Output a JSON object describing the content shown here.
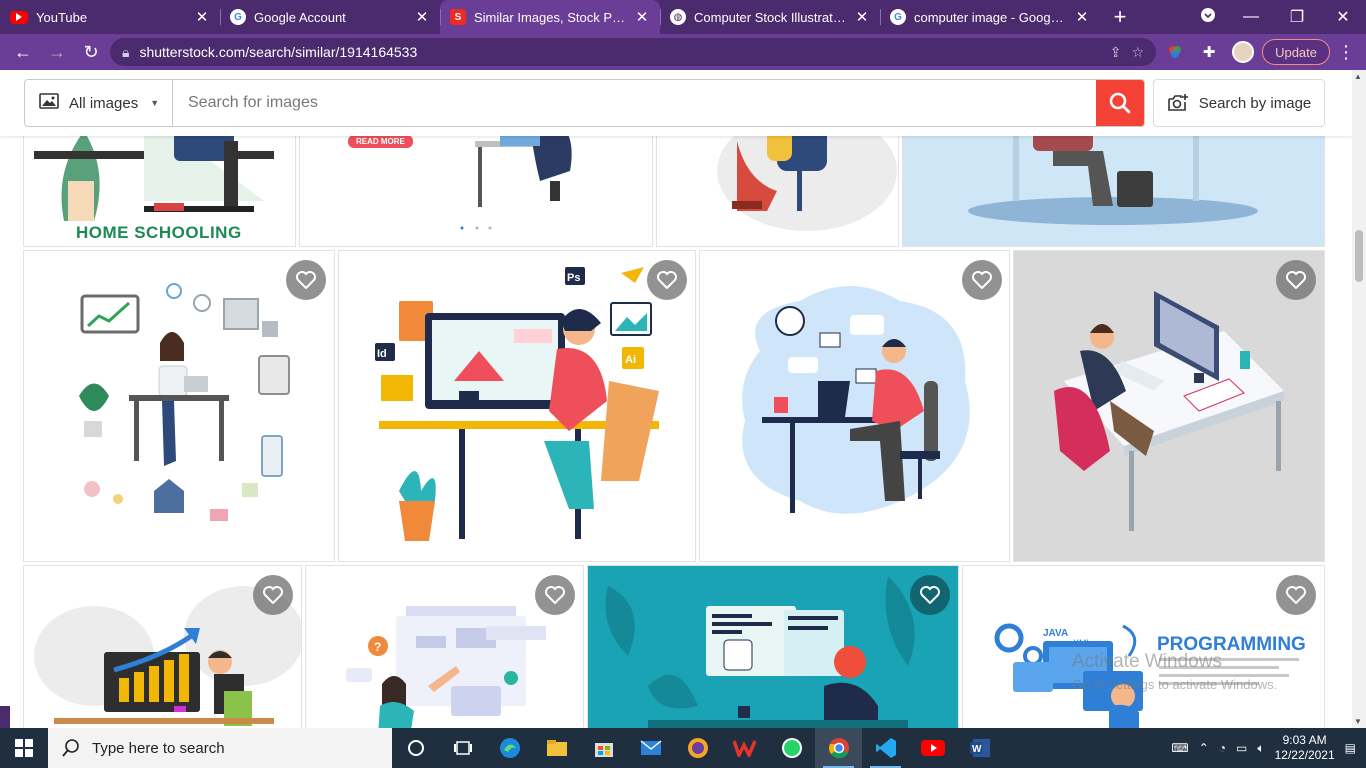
{
  "browser": {
    "tabs": [
      {
        "title": "YouTube",
        "icon": "youtube-icon",
        "color": "#ff0000",
        "active": false
      },
      {
        "title": "Google Account",
        "icon": "google-icon",
        "color": "#ffffff",
        "active": false
      },
      {
        "title": "Similar Images, Stock Photos",
        "icon": "shutterstock-icon",
        "color": "#ee2b24",
        "active": true
      },
      {
        "title": "Computer Stock Illustrations,",
        "icon": "globe-icon",
        "color": "#ffffff",
        "active": false
      },
      {
        "title": "computer image - Google Se",
        "icon": "google-icon",
        "color": "#ffffff",
        "active": false
      }
    ],
    "url": "shutterstock.com/search/similar/1914164533",
    "update_label": "Update"
  },
  "search": {
    "filter_label": "All images",
    "placeholder": "Search for images",
    "search_by_image_label": "Search by image"
  },
  "results": {
    "row0": {
      "caption": "HOME SCHOOLING",
      "read_more": "READ MORE"
    },
    "row2": {
      "programming_label": "PROGRAMMING"
    }
  },
  "watermark": {
    "line1": "Activate Windows",
    "line2": "Go to Settings to activate Windows."
  },
  "taskbar": {
    "search_placeholder": "Type here to search",
    "time": "9:03 AM",
    "date": "12/22/2021"
  },
  "colors": {
    "tab_bar": "#4b2a6e",
    "toolbar": "#6a3d96",
    "search_button": "#f44336",
    "taskbar": "#1f2f3f"
  }
}
